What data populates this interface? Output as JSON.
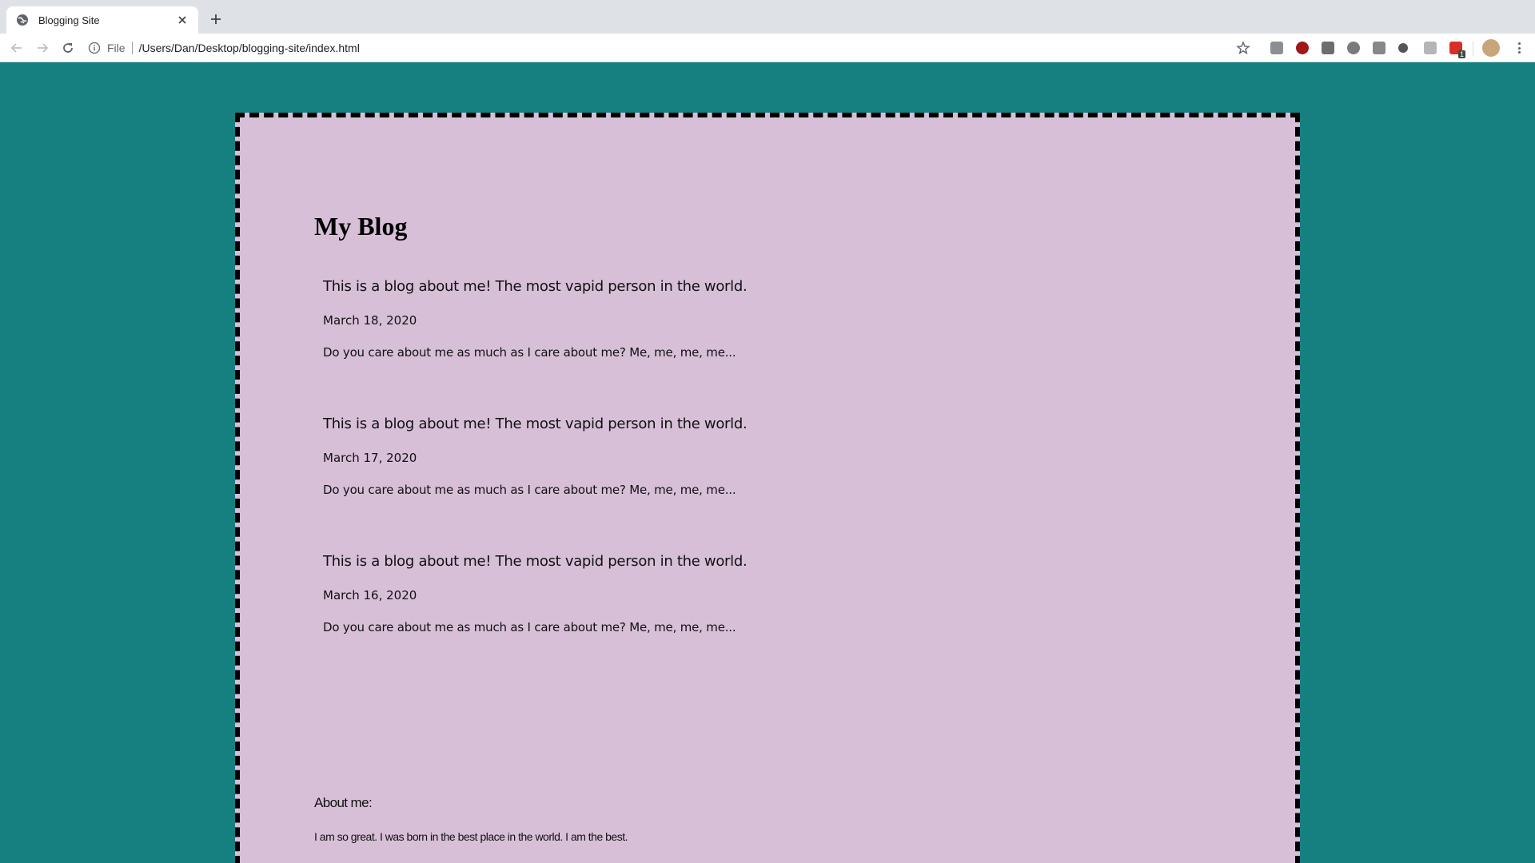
{
  "browser": {
    "tab_title": "Blogging Site",
    "url_scheme": "File",
    "url": "/Users/Dan/Desktop/blogging-site/index.html",
    "extensions": [
      "mail-ext-icon",
      "ublock-icon",
      "s-ext-icon",
      "circle-ext-icon",
      "g-ext-icon",
      "dark-circle-ext-icon",
      "translate-ext-icon",
      "red-badge-ext-icon"
    ],
    "extension_badge": "1"
  },
  "blog": {
    "title": "My Blog",
    "posts": [
      {
        "title": "This is a blog about me! The most vapid person in the world.",
        "date": "March 18, 2020",
        "excerpt": "Do you care about me as much as I care about me? Me, me, me, me..."
      },
      {
        "title": "This is a blog about me! The most vapid person in the world.",
        "date": "March 17, 2020",
        "excerpt": "Do you care about me as much as I care about me? Me, me, me, me..."
      },
      {
        "title": "This is a blog about me! The most vapid person in the world.",
        "date": "March 16, 2020",
        "excerpt": "Do you care about me as much as I care about me? Me, me, me, me..."
      }
    ],
    "about_heading": "About me:",
    "about_text": "I am so great. I was born in the best place in the world. I am the best."
  },
  "colors": {
    "page_background": "#167f7f",
    "card_background": "#d8bfd8",
    "card_border": "#000000"
  }
}
